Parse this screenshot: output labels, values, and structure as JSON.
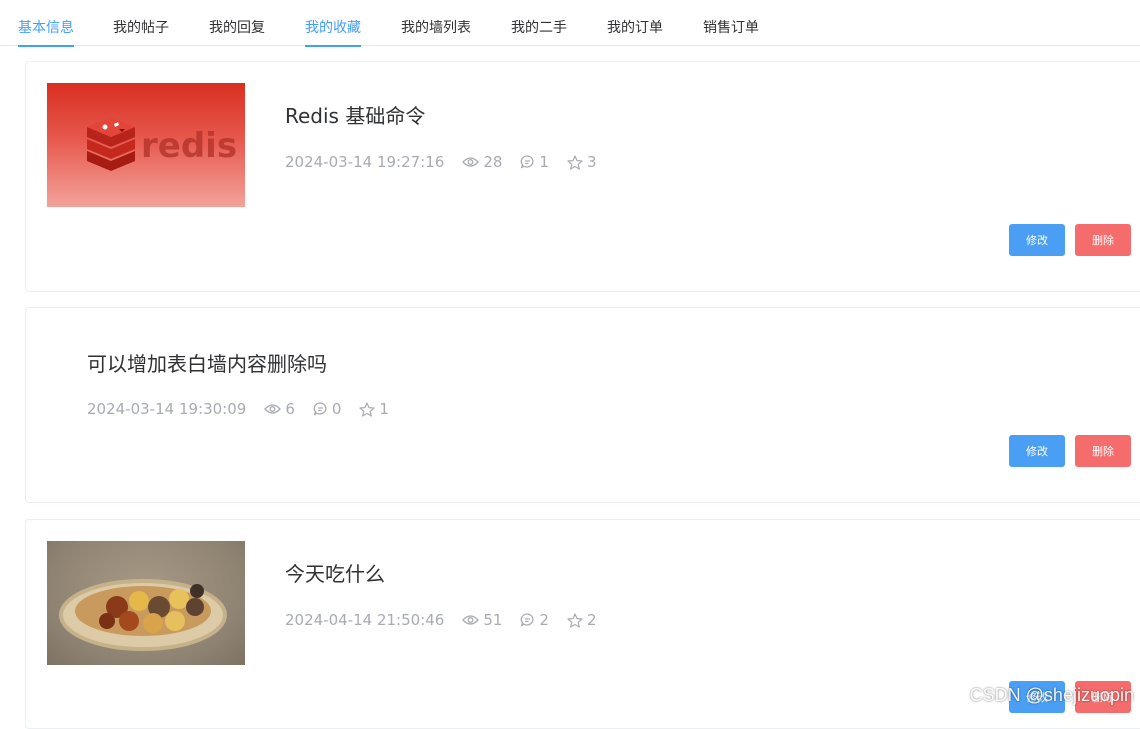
{
  "tabs": [
    {
      "label": "基本信息",
      "active": false
    },
    {
      "label": "我的帖子",
      "active": false
    },
    {
      "label": "我的回复",
      "active": false
    },
    {
      "label": "我的收藏",
      "active": true
    },
    {
      "label": "我的墙列表",
      "active": false
    },
    {
      "label": "我的二手",
      "active": false
    },
    {
      "label": "我的订单",
      "active": false
    },
    {
      "label": "销售订单",
      "active": false
    }
  ],
  "posts": [
    {
      "title": "Redis 基础命令",
      "time": "2024-03-14 19:27:16",
      "views": "28",
      "comments": "1",
      "stars": "3",
      "thumbnail": "redis-logo",
      "thumbnail_text": "redis"
    },
    {
      "title": "可以增加表白墙内容删除吗",
      "time": "2024-03-14 19:30:09",
      "views": "6",
      "comments": "0",
      "stars": "1",
      "thumbnail": ""
    },
    {
      "title": "今天吃什么",
      "time": "2024-04-14 21:50:46",
      "views": "51",
      "comments": "2",
      "stars": "2",
      "thumbnail": "food-basket-photo"
    }
  ],
  "buttons": {
    "edit": "修改",
    "delete": "删除"
  },
  "watermark": "CSDN @shejizuopin",
  "icons": {
    "views": "eye-icon",
    "comments": "comment-icon",
    "stars": "star-icon"
  },
  "colors": {
    "accent": "#409eff",
    "edit": "#4a9ff5",
    "delete": "#f56c6c",
    "meta": "#a8abb2"
  }
}
